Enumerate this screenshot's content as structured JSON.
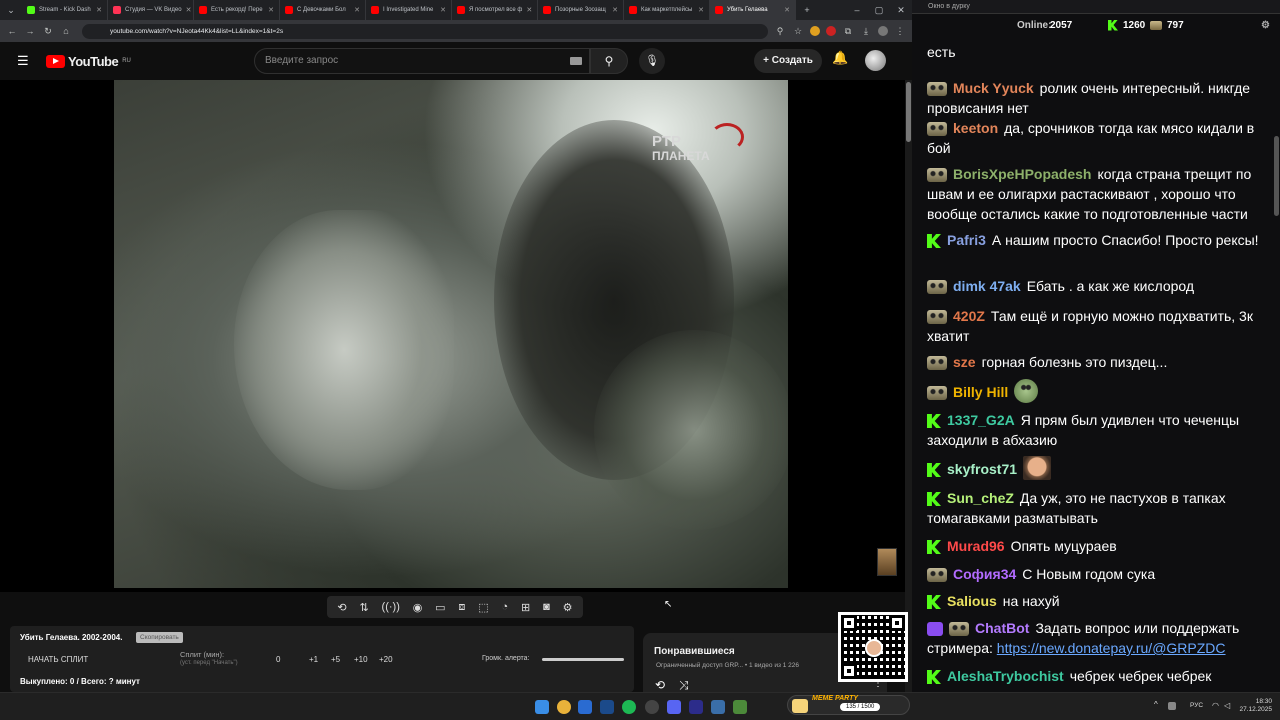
{
  "browser": {
    "tabs": [
      {
        "label": "Stream - Kick Dash",
        "color": "#53fc18"
      },
      {
        "label": "Студия — VK Видео",
        "color": "#ff3355"
      },
      {
        "label": "Есть рекорд! Пере",
        "color": "#ff0000"
      },
      {
        "label": "С Девочками Бол",
        "color": "#ff0000"
      },
      {
        "label": "I Investigated Mine",
        "color": "#ff0000"
      },
      {
        "label": "Я посмотрел все ф",
        "color": "#ff0000"
      },
      {
        "label": "Позорные Зоозащ",
        "color": "#ff0000"
      },
      {
        "label": "Как маркетплейсы",
        "color": "#ff0000"
      },
      {
        "label": "Убить Гелаева",
        "color": "#ff0000"
      }
    ],
    "new_tab": "+",
    "url": "youtube.com/watch?v=NJeota44Kk4&list=LL&index=1&t=2s"
  },
  "youtube": {
    "logo_text": "YouTube",
    "region": "RU",
    "search_placeholder": "Введите запрос",
    "create_label": "Создать",
    "watermark_top": "РТР",
    "watermark_bottom": "ПЛАНЕТА"
  },
  "split_panel": {
    "title": "Убить Гелаева. 2002-2004.",
    "copy_label": "Скопировать",
    "start_label": "НАЧАТЬ СПЛИТ",
    "split_label": "Сплит (мин):",
    "split_hint": "(уст. перед \"Начать\")",
    "steps": [
      "0",
      "+1",
      "+5",
      "+10",
      "+20"
    ],
    "alert_label": "Громк. алерта:",
    "status": "Выкуплено: 0 / Всего: ? минут"
  },
  "liked": {
    "title": "Понравившиеся",
    "subtitle": "Ограниченный доступ  GRP...  •  1 видео из 1 226"
  },
  "chat": {
    "window_title": "Окно в дурку",
    "online_label": "Online:",
    "online_value": "2057",
    "kick_count": "1260",
    "gob_count": "797",
    "messages": [
      {
        "badge": "none",
        "nick": "",
        "color": "#ffffff",
        "text": "есть"
      },
      {
        "badge": "gob",
        "nick": "Muck Yyuck",
        "color": "#e2855a",
        "text": "ролик очень интересный. никгде провисания нет"
      },
      {
        "badge": "gob",
        "nick": "keeton",
        "color": "#e2855a",
        "text": "да, срочников тогда как мясо кидали в бой"
      },
      {
        "badge": "gob",
        "nick": "BorisXpeHPopadesh",
        "color": "#8db06a",
        "text": "когда страна трещит по швам и ее олигархи растаскивают , хорошо что вообще остались какие то подготовленные части"
      },
      {
        "badge": "kick",
        "nick": "Pafri3",
        "color": "#88a0e0",
        "text": "А нашим просто Спасибо! Просто рексы!"
      },
      {
        "badge": "gob",
        "nick": "dimk 47ak",
        "color": "#7eaef0",
        "text": "Ебать . а как же кислород"
      },
      {
        "badge": "gob",
        "nick": "420Z",
        "color": "#e2774a",
        "text": "Там ещё и горную можно подхватить, 3к хватит"
      },
      {
        "badge": "gob",
        "nick": "sze",
        "color": "#e2774a",
        "text": "горная болезнь это пиздец..."
      },
      {
        "badge": "gob",
        "nick": "Billy Hill",
        "color": "#f0b400",
        "text": "",
        "emote": "frog"
      },
      {
        "badge": "kick",
        "nick": "1337_G2A",
        "color": "#3ec9a0",
        "text": "Я прям был удивлен что чеченцы заходили в абхазию"
      },
      {
        "badge": "kick",
        "nick": "skyfrost71",
        "color": "#a8f0c8",
        "text": "",
        "emote": "man"
      },
      {
        "badge": "kick",
        "nick": "Sun_cheZ",
        "color": "#b6f07a",
        "text": "Да уж, это не пастухов в тапках томагавками разматывать"
      },
      {
        "badge": "kick",
        "nick": "Murad96",
        "color": "#ff4a4a",
        "text": "Опять муцураев"
      },
      {
        "badge": "gob",
        "nick": "София34",
        "color": "#b26bff",
        "text": "С Новым годом сука"
      },
      {
        "badge": "kick",
        "nick": "Salious",
        "color": "#e8e060",
        "text": "на нахуй"
      },
      {
        "badge": "bot",
        "nick": "ChatBot",
        "color": "#b47bff",
        "text": "Задать вопрос или поддержать стримера:",
        "link": "https://new.donatepay.ru/@GRPZDC"
      },
      {
        "badge": "kick",
        "nick": "AleshaTrybochist",
        "color": "#3ec9a0",
        "text": "чебрек чебрек чебрек"
      }
    ]
  },
  "taskbar": {
    "meme_label": "MEME PARTY",
    "meme_value": "135 / 1500",
    "lang": "РУС",
    "time": "18:30",
    "date": "27.12.2025"
  }
}
